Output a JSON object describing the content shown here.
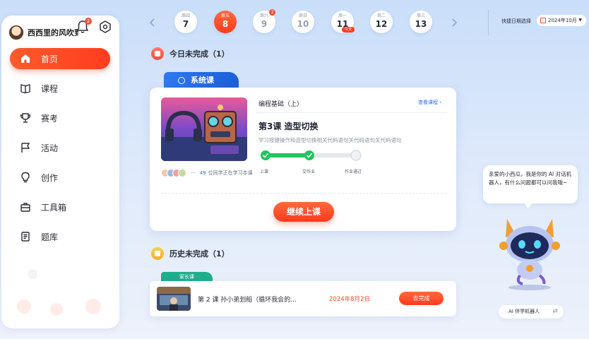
{
  "user": {
    "name": "西西里的风吹到...",
    "notification_count": "2"
  },
  "sidebar": {
    "items": [
      {
        "label": "首页",
        "icon": "home-icon",
        "active": true
      },
      {
        "label": "课程",
        "icon": "book-icon"
      },
      {
        "label": "赛考",
        "icon": "trophy-icon"
      },
      {
        "label": "活动",
        "icon": "flag-icon"
      },
      {
        "label": "创作",
        "icon": "lightbulb-icon"
      },
      {
        "label": "工具箱",
        "icon": "toolbox-icon"
      },
      {
        "label": "题库",
        "icon": "question-bank-icon"
      }
    ]
  },
  "dates": [
    {
      "weekday": "周四",
      "day": "7"
    },
    {
      "weekday": "周五",
      "day": "8",
      "active": true
    },
    {
      "weekday": "周六",
      "day": "9",
      "badge": "2"
    },
    {
      "weekday": "周日",
      "day": "10"
    },
    {
      "weekday": "周一",
      "day": "11",
      "tag": "今天"
    },
    {
      "weekday": "周二",
      "day": "12"
    },
    {
      "weekday": "周三",
      "day": "13"
    }
  ],
  "date_picker": {
    "label": "快捷日期选择",
    "month": "2024年10月"
  },
  "today": {
    "title": "今日未完成（1）",
    "tab": "系统课",
    "course_subtitle": "编程基础（上）",
    "view_course": "查看课程",
    "lesson_title": "第3课  造型切换",
    "lesson_desc": "学习按键操作和造型切换相关代码语句关代码语句关代码语句",
    "steps": [
      "上课",
      "交作业",
      "作业通过"
    ],
    "progress_completed_steps": 2,
    "learners_count": "49",
    "learners_text": "位同学正在学习本课",
    "continue_label": "继续上课"
  },
  "history": {
    "title": "历史未完成（1）",
    "tab": "家长课",
    "lesson_title": "第 2 课   孙小弟划船（循环我会的...",
    "date": "2024年8月2日",
    "action_label": "去完成"
  },
  "assistant": {
    "message": "亲爱的小西瓜，我是你的 AI 对话机器人，有什么问题都可以问我哦~",
    "switch_label": "AI 伴学机器人",
    "switch_icon": "⇄"
  },
  "colors": {
    "accent": "#ff4a2a",
    "primary_blue": "#2e78f0",
    "green": "#22c55e",
    "teal": "#1fae8a"
  }
}
